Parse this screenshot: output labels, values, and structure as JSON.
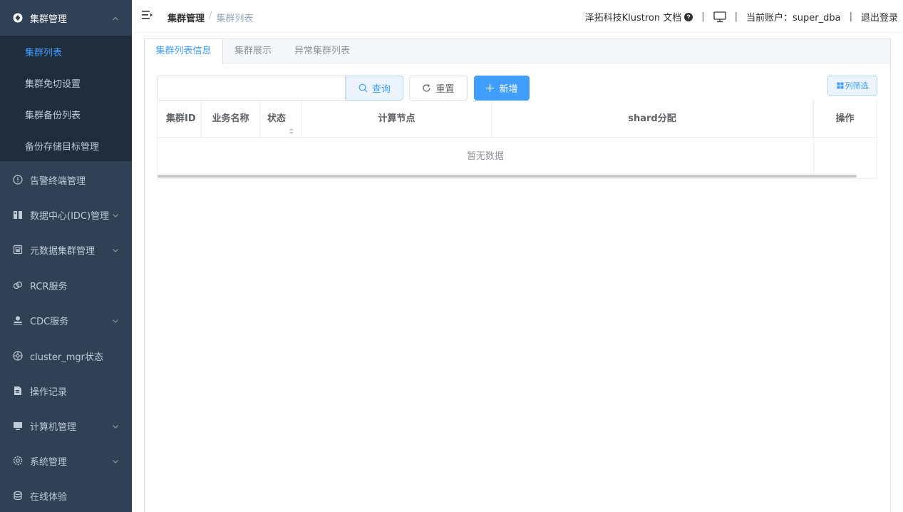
{
  "sidebar": {
    "group_open": {
      "label": "集群管理",
      "icon": "cluster-icon"
    },
    "sub_items": [
      {
        "label": "集群列表",
        "active": true
      },
      {
        "label": "集群免切设置"
      },
      {
        "label": "集群备份列表"
      },
      {
        "label": "备份存储目标管理"
      }
    ],
    "items": [
      {
        "label": "告警终端管理",
        "icon": "alert-icon",
        "has_arrow": false
      },
      {
        "label": "数据中心(IDC)管理",
        "icon": "datacenter-icon",
        "has_arrow": true
      },
      {
        "label": "元数据集群管理",
        "icon": "metadata-icon",
        "has_arrow": true
      },
      {
        "label": "RCR服务",
        "icon": "link-icon",
        "has_arrow": false
      },
      {
        "label": "CDC服务",
        "icon": "user-icon",
        "has_arrow": true
      },
      {
        "label": "cluster_mgr状态",
        "icon": "status-icon",
        "has_arrow": false
      },
      {
        "label": "操作记录",
        "icon": "record-icon",
        "has_arrow": false
      },
      {
        "label": "计算机管理",
        "icon": "computer-icon",
        "has_arrow": true
      },
      {
        "label": "系统管理",
        "icon": "gear-icon",
        "has_arrow": true
      },
      {
        "label": "在线体验",
        "icon": "database-icon",
        "has_arrow": false
      }
    ]
  },
  "header": {
    "breadcrumb": {
      "parent": "集群管理",
      "separator": "/",
      "current": "集群列表"
    },
    "docs_label": "泽拓科技Klustron 文档",
    "separator": "|",
    "account_label": "当前账户：super_dba",
    "logout_label": "退出登录"
  },
  "tabs": [
    {
      "label": "集群列表信息",
      "active": true
    },
    {
      "label": "集群展示"
    },
    {
      "label": "异常集群列表"
    }
  ],
  "toolbar": {
    "search_placeholder": "",
    "query_label": "查询",
    "reset_label": "重置",
    "add_label": "新增",
    "filter_label": "列筛选"
  },
  "table": {
    "columns": [
      "集群ID",
      "业务名称",
      "状态",
      "计算节点",
      "shard分配",
      "操作"
    ],
    "empty_text": "暂无数据"
  },
  "colors": {
    "sidebar_bg": "#304156",
    "submenu_bg": "#1f2d3d",
    "accent": "#409eff",
    "sidebar_text": "#bfcbd9"
  }
}
